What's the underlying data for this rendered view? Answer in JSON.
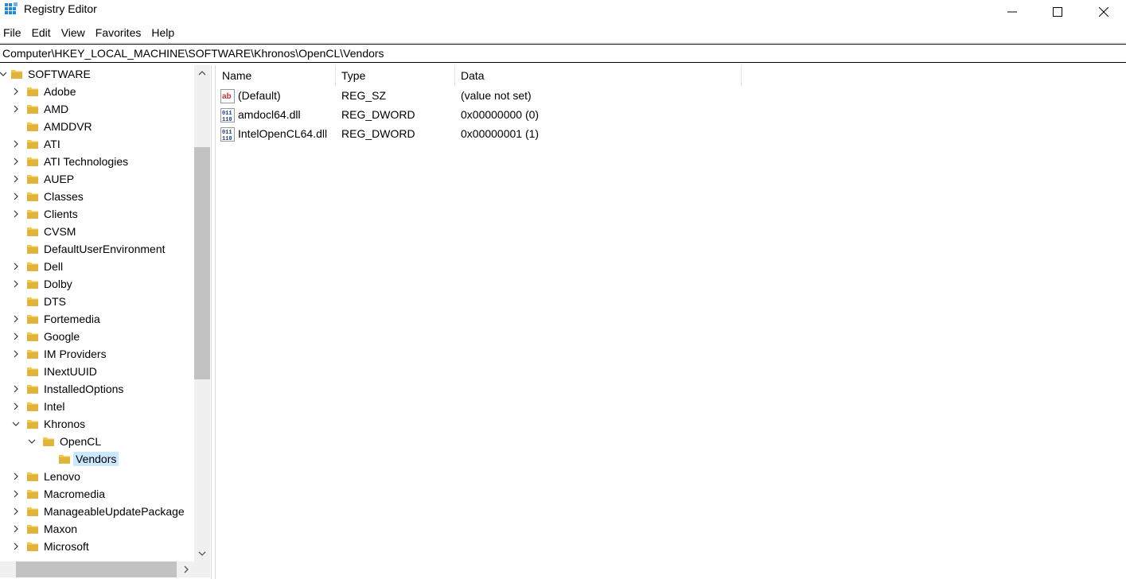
{
  "window": {
    "title": "Registry Editor",
    "controls": {
      "minimize": "minimize-icon",
      "maximize": "maximize-icon",
      "close": "close-icon"
    }
  },
  "menu": [
    "File",
    "Edit",
    "View",
    "Favorites",
    "Help"
  ],
  "address": "Computer\\HKEY_LOCAL_MACHINE\\SOFTWARE\\Khronos\\OpenCL\\Vendors",
  "tree": {
    "root": "SOFTWARE",
    "items": [
      {
        "label": "Adobe",
        "expandable": true
      },
      {
        "label": "AMD",
        "expandable": true
      },
      {
        "label": "AMDDVR",
        "expandable": false
      },
      {
        "label": "ATI",
        "expandable": true
      },
      {
        "label": "ATI Technologies",
        "expandable": true
      },
      {
        "label": "AUEP",
        "expandable": true
      },
      {
        "label": "Classes",
        "expandable": true
      },
      {
        "label": "Clients",
        "expandable": true
      },
      {
        "label": "CVSM",
        "expandable": false
      },
      {
        "label": "DefaultUserEnvironment",
        "expandable": false
      },
      {
        "label": "Dell",
        "expandable": true
      },
      {
        "label": "Dolby",
        "expandable": true
      },
      {
        "label": "DTS",
        "expandable": false
      },
      {
        "label": "Fortemedia",
        "expandable": true
      },
      {
        "label": "Google",
        "expandable": true
      },
      {
        "label": "IM Providers",
        "expandable": true
      },
      {
        "label": "INextUUID",
        "expandable": false
      },
      {
        "label": "InstalledOptions",
        "expandable": true
      },
      {
        "label": "Intel",
        "expandable": true
      },
      {
        "label": "Khronos",
        "expandable": true,
        "expanded": true
      },
      {
        "label": "OpenCL",
        "expandable": true,
        "expanded": true,
        "level": 2
      },
      {
        "label": "Vendors",
        "expandable": false,
        "level": 3,
        "selected": true
      },
      {
        "label": "Lenovo",
        "expandable": true
      },
      {
        "label": "Macromedia",
        "expandable": true
      },
      {
        "label": "ManageableUpdatePackage",
        "expandable": true
      },
      {
        "label": "Maxon",
        "expandable": true
      },
      {
        "label": "Microsoft",
        "expandable": true
      }
    ]
  },
  "columns": [
    "Name",
    "Type",
    "Data"
  ],
  "values": [
    {
      "name": "(Default)",
      "type": "REG_SZ",
      "data": "(value not set)",
      "icon": "string-value-icon"
    },
    {
      "name": "amdocl64.dll",
      "type": "REG_DWORD",
      "data": "0x00000000 (0)",
      "icon": "binary-value-icon"
    },
    {
      "name": "IntelOpenCL64.dll",
      "type": "REG_DWORD",
      "data": "0x00000001 (1)",
      "icon": "binary-value-icon"
    }
  ],
  "colors": {
    "selection": "#cce8ff",
    "folder": "#f2c94c",
    "scroll_thumb": "#c2c2c2"
  }
}
